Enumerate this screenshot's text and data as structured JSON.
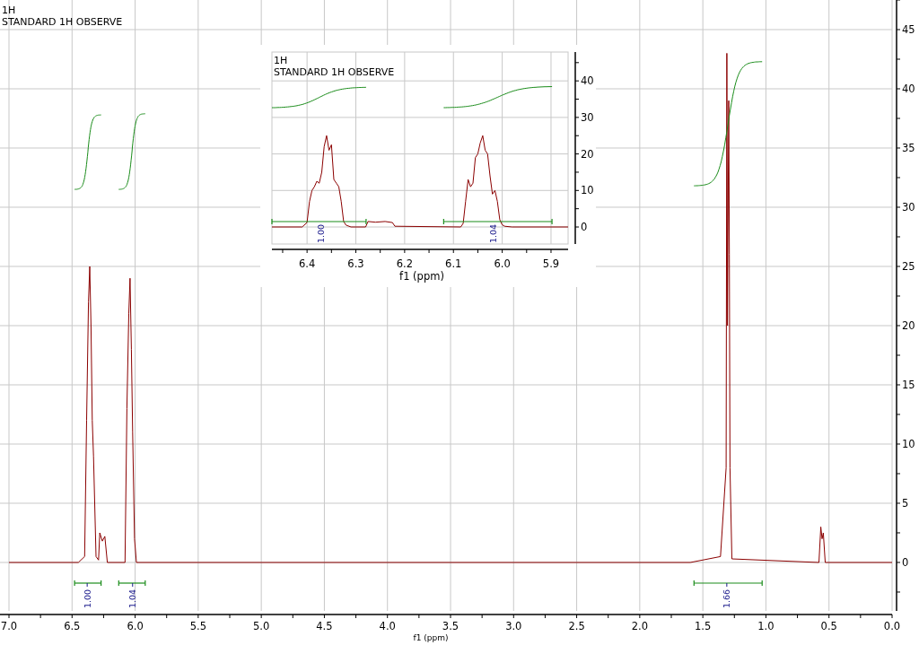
{
  "title": {
    "line_1": "1H",
    "line_2": "STANDARD 1H OBSERVE"
  },
  "spectrum": {
    "chart_data": {
      "type": "line",
      "grid": true,
      "xlabel": "f1 (ppm)",
      "xlim": [
        7,
        0
      ],
      "ylim": [
        -4.1,
        47.5
      ],
      "xticks": [
        {
          "value": 7,
          "label": "7.0"
        },
        {
          "value": 6.5,
          "label": "6.5"
        },
        {
          "value": 6,
          "label": "6.0"
        },
        {
          "value": 5.5,
          "label": "5.5"
        },
        {
          "value": 5,
          "label": "5.0"
        },
        {
          "value": 4.5,
          "label": "4.5"
        },
        {
          "value": 4,
          "label": "4.0"
        },
        {
          "value": 3.5,
          "label": "3.5"
        },
        {
          "value": 3,
          "label": "3.0"
        },
        {
          "value": 2.5,
          "label": "2.5"
        },
        {
          "value": 2,
          "label": "2.0"
        },
        {
          "value": 1.5,
          "label": "1.5"
        },
        {
          "value": 1,
          "label": "1.0"
        },
        {
          "value": 0.5,
          "label": "0.5"
        },
        {
          "value": 0,
          "label": "0.0"
        }
      ],
      "yticks": [
        0,
        5,
        10,
        15,
        20,
        25,
        30,
        35,
        40,
        45
      ],
      "x": [
        7.0,
        6.45,
        6.4,
        6.385,
        6.37,
        6.36,
        6.35,
        6.34,
        6.33,
        6.31,
        6.29,
        6.28,
        6.26,
        6.24,
        6.22,
        6.08,
        6.065,
        6.05,
        6.04,
        6.03,
        6.02,
        6.005,
        5.99,
        1.6,
        1.36,
        1.315,
        1.31,
        1.305,
        1.3,
        1.295,
        1.29,
        1.285,
        1.27,
        0.58,
        0.565,
        0.555,
        0.545,
        0.53,
        0.0
      ],
      "series": [
        {
          "color": "#8b0000",
          "values": [
            0,
            0,
            0.5,
            12,
            22,
            25,
            20,
            12,
            9,
            0.5,
            0.2,
            2.5,
            1.8,
            2.2,
            0,
            0,
            13,
            21,
            24,
            18,
            11,
            2,
            0,
            0,
            0.5,
            8,
            43,
            20,
            30,
            39,
            26,
            8,
            0.3,
            0,
            3,
            2,
            2.5,
            0,
            0
          ]
        }
      ],
      "annotations": [
        "1.00",
        "1.04",
        "1.66"
      ]
    }
  },
  "inset": {
    "title": {
      "line_1": "1H",
      "line_2": "STANDARD 1H OBSERVE"
    },
    "chart_data": {
      "type": "line",
      "grid": true,
      "xlabel": "f1 (ppm)",
      "xlim": [
        6.472,
        5.865
      ],
      "ylim": [
        -4.66,
        47.9
      ],
      "xticks": [
        {
          "value": 6.4,
          "label": "6.4"
        },
        {
          "value": 6.3,
          "label": "6.3"
        },
        {
          "value": 6.2,
          "label": "6.2"
        },
        {
          "value": 6.1,
          "label": "6.1"
        },
        {
          "value": 6.0,
          "label": "6.0"
        },
        {
          "value": 5.9,
          "label": "5.9"
        }
      ],
      "yticks": [
        0,
        10,
        20,
        30,
        40
      ],
      "x": [
        6.472,
        6.41,
        6.4,
        6.395,
        6.39,
        6.385,
        6.38,
        6.375,
        6.37,
        6.365,
        6.36,
        6.355,
        6.35,
        6.345,
        6.34,
        6.335,
        6.33,
        6.325,
        6.32,
        6.31,
        6.28,
        6.275,
        6.26,
        6.24,
        6.225,
        6.22,
        6.085,
        6.08,
        6.075,
        6.07,
        6.065,
        6.06,
        6.055,
        6.05,
        6.045,
        6.04,
        6.035,
        6.03,
        6.025,
        6.02,
        6.015,
        6.01,
        6.005,
        6.0,
        5.995,
        5.98,
        5.865
      ],
      "series": [
        {
          "color": "#8b0000",
          "values": [
            0,
            0,
            1.2,
            7,
            10,
            11,
            12.5,
            12,
            15,
            22,
            25,
            21,
            22.5,
            13,
            12,
            11,
            7,
            1.5,
            0.5,
            0,
            0,
            1.5,
            1.3,
            1.5,
            1.2,
            0.2,
            0,
            1,
            7,
            13,
            11,
            12,
            19,
            20,
            23,
            25,
            21,
            20,
            14,
            9,
            10,
            7,
            2,
            0.6,
            0.2,
            0,
            0
          ]
        }
      ],
      "annotations": [
        "1.00",
        "1.04"
      ]
    }
  }
}
